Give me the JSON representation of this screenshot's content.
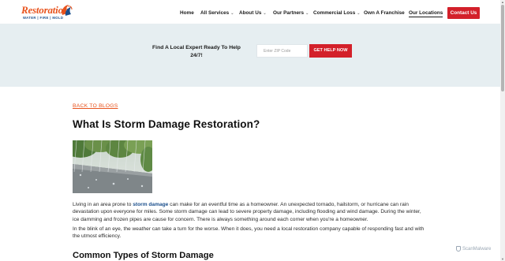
{
  "header": {
    "logo_word": "Restoration",
    "logo_tagline": "WATER | FIRE | MOLD",
    "nav": [
      {
        "label": "Home",
        "dropdown": false
      },
      {
        "label": "All Services",
        "dropdown": true
      },
      {
        "label": "About Us",
        "dropdown": true
      },
      {
        "label": "Our Partners",
        "dropdown": true
      },
      {
        "label": "Commercial Loss",
        "dropdown": true
      },
      {
        "label": "Own A Franchise",
        "dropdown": false
      },
      {
        "label": "Our Locations",
        "dropdown": false,
        "active": true
      }
    ],
    "contact_label": "Contact Us"
  },
  "banner": {
    "text": "Find A Local Expert Ready To Help 24/7!",
    "zip_placeholder": "Enter ZIP Code",
    "button_label": "GET HELP NOW"
  },
  "article": {
    "back_link": "BACK TO BLOGS",
    "title": "What Is Storm Damage Restoration?",
    "para1_before": "Living in an area prone to ",
    "para1_link": "storm damage",
    "para1_after": " can make for an eventful time as a homeowner. An unexpected tornado, hailstorm, or hurricane can rain devastation upon everyone for miles. Some storm damage can lead to severe property damage, including flooding and wind damage. During the winter, ice damming and frozen pipes are cause for concern. There is always something around each corner when you're a homeowner.",
    "para2": "In the blink of an eye, the weather can take a turn for the worse. When it does, you need a local restoration company capable of responding fast and with the utmost efficiency.",
    "subheading": "Common Types of Storm Damage"
  },
  "watermark": "ScanMalware",
  "colors": {
    "brand_orange": "#e8531d",
    "brand_red": "#d3202a",
    "brand_blue": "#1b4f8c",
    "banner_bg": "#e6eef1"
  },
  "icons": {
    "logo_mark": "swirl-icon",
    "dropdown": "chevron-down-icon"
  }
}
